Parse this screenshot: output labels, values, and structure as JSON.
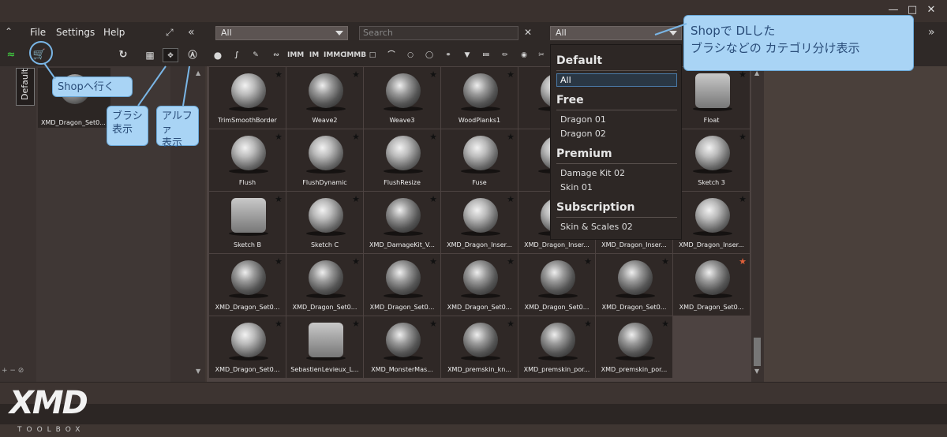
{
  "menu": {
    "file": "File",
    "settings": "Settings",
    "help": "Help"
  },
  "filters": {
    "left": "All",
    "search_placeholder": "Search",
    "category": "All"
  },
  "left_panel": {
    "tab_label": "Default",
    "item_label": "XMD_Dragon_Set0..."
  },
  "grid": [
    {
      "label": "TrimSmoothBorder",
      "style": "sphere"
    },
    {
      "label": "Weave2",
      "style": "bumpy"
    },
    {
      "label": "Weave3",
      "style": "bumpy"
    },
    {
      "label": "WoodPlanks1",
      "style": "bumpy"
    },
    {
      "label": "Woo",
      "style": "sphere"
    },
    {
      "label": "",
      "style": "sphere"
    },
    {
      "label": "Float",
      "style": "flat"
    },
    {
      "label": "Flush",
      "style": "sphere"
    },
    {
      "label": "FlushDynamic",
      "style": "sphere"
    },
    {
      "label": "FlushResize",
      "style": "sphere"
    },
    {
      "label": "Fuse",
      "style": "sphere"
    },
    {
      "label": "Pu",
      "style": "sphere"
    },
    {
      "label": "",
      "style": "sphere"
    },
    {
      "label": "Sketch 3",
      "style": "sphere"
    },
    {
      "label": "Sketch B",
      "style": "flat"
    },
    {
      "label": "Sketch C",
      "style": "sphere"
    },
    {
      "label": "XMD_DamageKit_V...",
      "style": "bumpy"
    },
    {
      "label": "XMD_Dragon_Inser...",
      "style": "sphere"
    },
    {
      "label": "XMD_Dragon_Inser...",
      "style": "sphere"
    },
    {
      "label": "XMD_Dragon_Inser...",
      "style": "sphere"
    },
    {
      "label": "XMD_Dragon_Inser...",
      "style": "sphere"
    },
    {
      "label": "XMD_Dragon_Set0...",
      "style": "bumpy"
    },
    {
      "label": "XMD_Dragon_Set0...",
      "style": "bumpy"
    },
    {
      "label": "XMD_Dragon_Set0...",
      "style": "bumpy"
    },
    {
      "label": "XMD_Dragon_Set0...",
      "style": "bumpy"
    },
    {
      "label": "XMD_Dragon_Set0...",
      "style": "bumpy"
    },
    {
      "label": "XMD_Dragon_Set0...",
      "style": "bumpy"
    },
    {
      "label": "XMD_Dragon_Set0...",
      "style": "bumpy",
      "star": "orange"
    },
    {
      "label": "XMD_Dragon_Set0...",
      "style": "sphere"
    },
    {
      "label": "SebastienLevieux_L...",
      "style": "flat"
    },
    {
      "label": "XMD_MonsterMas...",
      "style": "bumpy"
    },
    {
      "label": "XMD_premskin_kn...",
      "style": "bumpy"
    },
    {
      "label": "XMD_premskin_por...",
      "style": "bumpy"
    },
    {
      "label": "XMD_premskin_por...",
      "style": "bumpy"
    }
  ],
  "dropdown": {
    "sections": [
      {
        "title": "Default",
        "items": [
          "All"
        ]
      },
      {
        "title": "Free",
        "items": [
          "Dragon 01",
          "Dragon 02"
        ]
      },
      {
        "title": "Premium",
        "items": [
          "Damage Kit 02",
          "Skin 01"
        ]
      },
      {
        "title": "Subscription",
        "items": [
          "Skin & Scales 02"
        ]
      }
    ]
  },
  "notes": {
    "shop_category": "Shopで DLした\nブラシなどの カテゴリ分け表示",
    "shop_go": "Shopへ行く",
    "brush_show": "ブラシ\n表示",
    "alpha_show": "アルファ\n表示"
  },
  "logo": {
    "main": "XMD",
    "sub": "TOOLBOX"
  }
}
